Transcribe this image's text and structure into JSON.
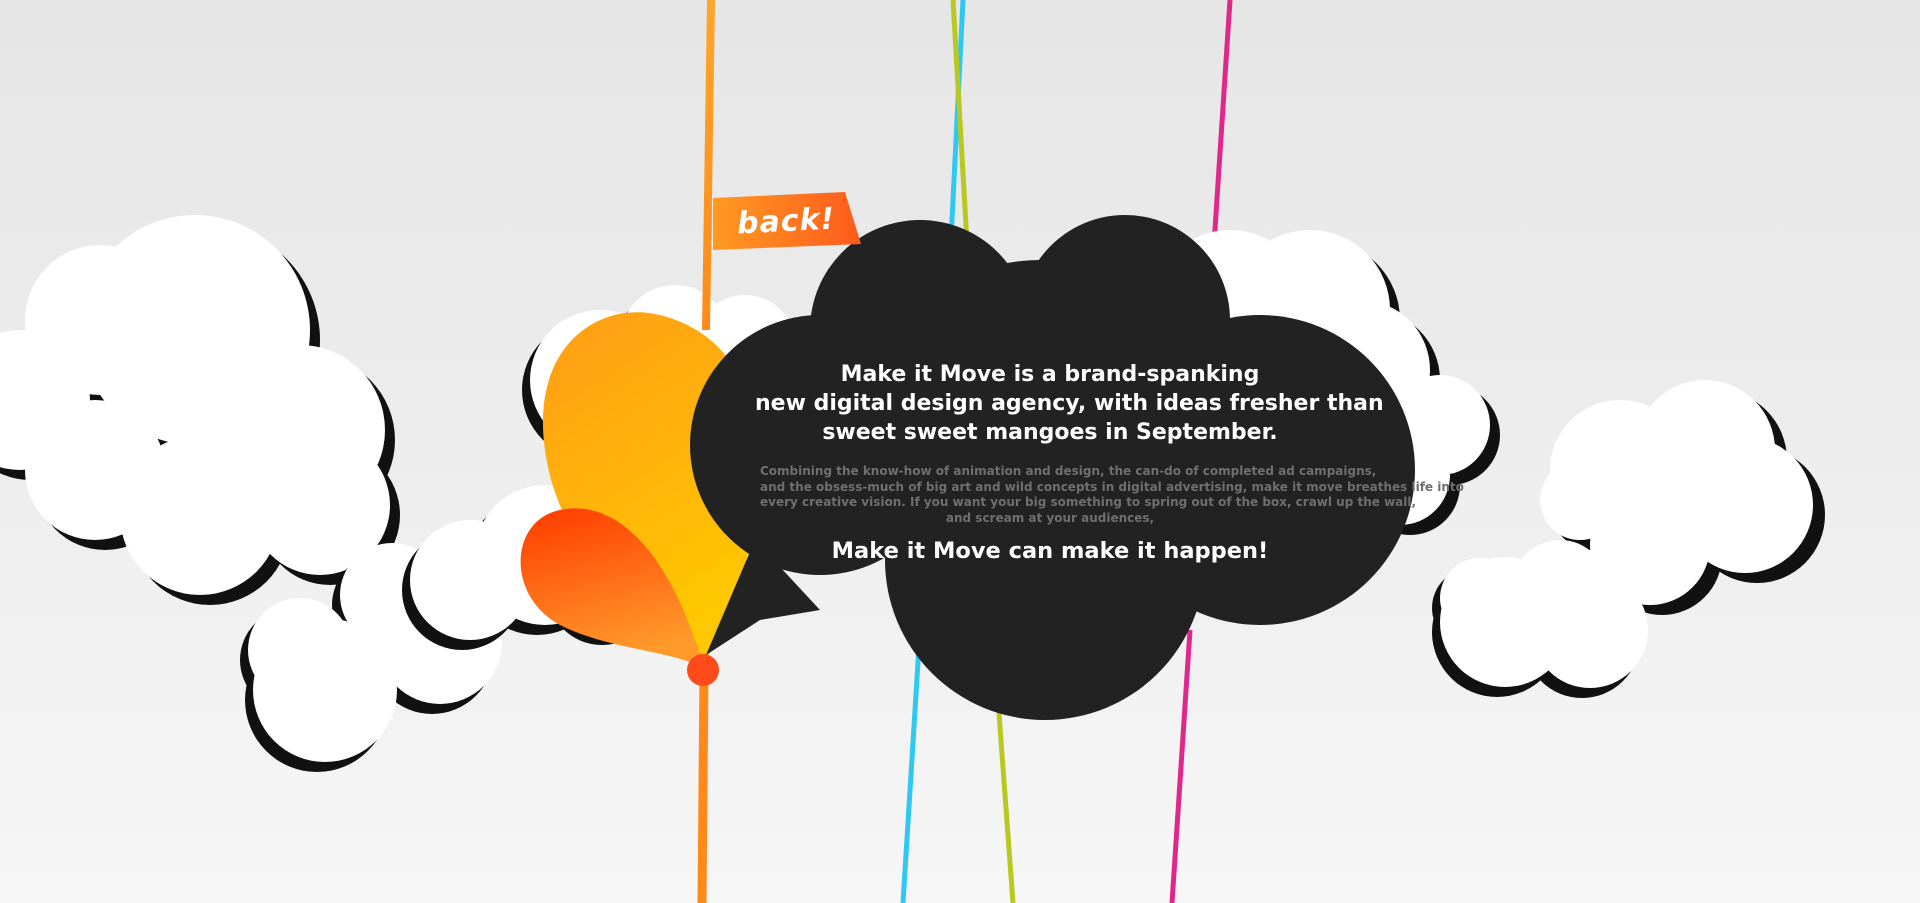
{
  "nav": {
    "back_label": "back!"
  },
  "hero": {
    "headline_lines": [
      "Make it Move is a brand-spanking",
      "new digital design agency, with ideas fresher than",
      "sweet sweet mangoes in September."
    ],
    "body_lines": [
      "Combining the know-how of animation and design, the can-do of completed ad campaigns,",
      "and the obsess-much of big art and wild concepts in digital advertising, make it move breathes life into",
      "every creative vision. If you want your big something to spring out of the box, crawl up the wall,",
      "and scream at your audiences,"
    ],
    "closing": "Make it Move can make it happen!"
  },
  "colors": {
    "bubble": "#222222",
    "cloud": "#ffffff",
    "cloud_shadow": "#111111",
    "orange": "#ff9a1e",
    "orange_dark": "#ff5a1f",
    "cyan_string": "#2ec8f2",
    "lime_string": "#b8c81e",
    "pink_string": "#e0288a",
    "headline_text": "#ffffff",
    "body_text": "#6f6f6f"
  }
}
